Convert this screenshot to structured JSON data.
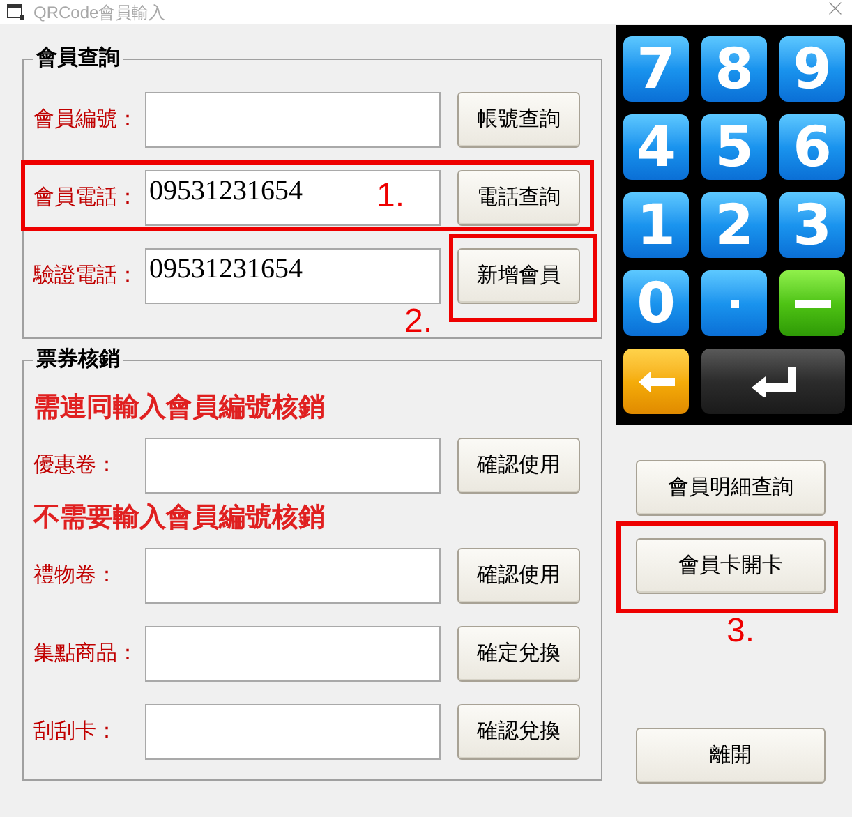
{
  "window": {
    "title": "QRCode會員輸入",
    "active": false
  },
  "member_query": {
    "title": "會員查詢",
    "rows": [
      {
        "label": "會員編號：",
        "value": "",
        "button": "帳號查詢"
      },
      {
        "label": "會員電話：",
        "value": "09531231654",
        "button": "電話查詢"
      },
      {
        "label": "驗證電話：",
        "value": "09531231654",
        "button": "新增會員"
      }
    ]
  },
  "voucher": {
    "title": "票券核銷",
    "sections": [
      {
        "heading": "需連同輸入會員編號核銷",
        "rows": [
          {
            "label": "優惠卷：",
            "value": "",
            "button": "確認使用"
          }
        ]
      },
      {
        "heading": "不需要輸入會員編號核銷",
        "rows": [
          {
            "label": "禮物卷：",
            "value": "",
            "button": "確認使用"
          },
          {
            "label": "集點商品：",
            "value": "",
            "button": "確定兌換"
          },
          {
            "label": "刮刮卡：",
            "value": "",
            "button": "確認兌換"
          }
        ]
      }
    ]
  },
  "keypad": [
    {
      "kind": "digit",
      "label": "7"
    },
    {
      "kind": "digit",
      "label": "8"
    },
    {
      "kind": "digit",
      "label": "9"
    },
    {
      "kind": "digit",
      "label": "4"
    },
    {
      "kind": "digit",
      "label": "5"
    },
    {
      "kind": "digit",
      "label": "6"
    },
    {
      "kind": "digit",
      "label": "1"
    },
    {
      "kind": "digit",
      "label": "2"
    },
    {
      "kind": "digit",
      "label": "3"
    },
    {
      "kind": "digit",
      "label": "0"
    },
    {
      "kind": "dot"
    },
    {
      "kind": "minus"
    },
    {
      "kind": "backspace"
    },
    {
      "kind": "enter"
    }
  ],
  "side_buttons": [
    "會員明細查詢",
    "會員卡開卡",
    "離開"
  ],
  "annotations": [
    {
      "label": "1."
    },
    {
      "label": "2."
    },
    {
      "label": "3."
    }
  ]
}
